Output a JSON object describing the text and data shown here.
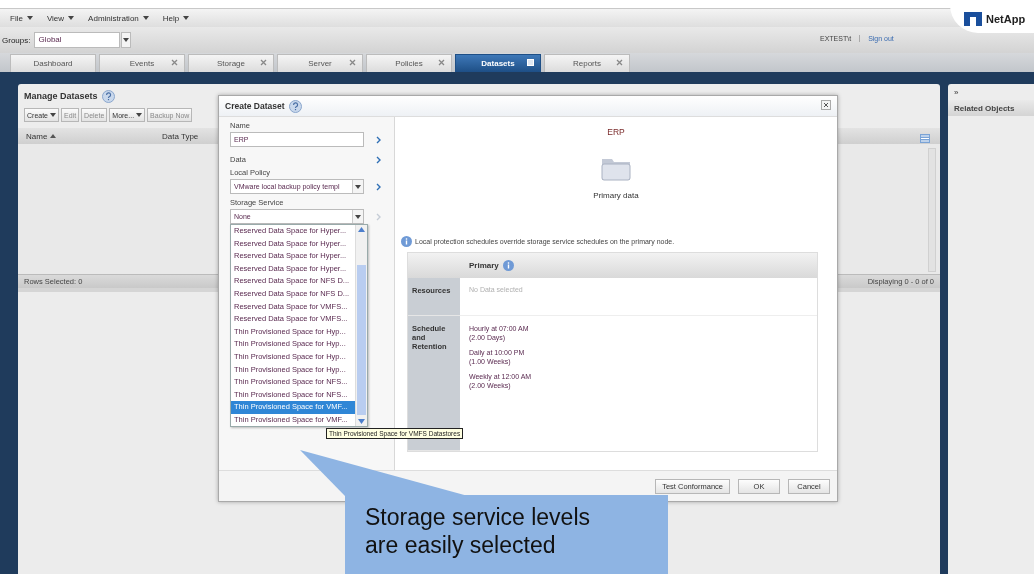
{
  "menu": [
    {
      "label": "File"
    },
    {
      "label": "View"
    },
    {
      "label": "Administration"
    },
    {
      "label": "Help"
    }
  ],
  "groups": {
    "label": "Groups:",
    "value": "Global"
  },
  "user": {
    "name": "EXTEST\\t",
    "link": "Sign out"
  },
  "logo": "NetApp",
  "tabs": [
    {
      "label": "Dashboard",
      "selected": false,
      "closable": false
    },
    {
      "label": "Events",
      "selected": false,
      "closable": true
    },
    {
      "label": "Storage",
      "selected": false,
      "closable": true
    },
    {
      "label": "Server",
      "selected": false,
      "closable": true
    },
    {
      "label": "Policies",
      "selected": false,
      "closable": true
    },
    {
      "label": "Datasets",
      "selected": true,
      "closable": true
    },
    {
      "label": "Reports",
      "selected": false,
      "closable": true
    }
  ],
  "manage": {
    "title": "Manage Datasets",
    "toolbar": [
      {
        "label": "Create",
        "dropdown": true,
        "disabled": false
      },
      {
        "label": "Edit",
        "dropdown": false,
        "disabled": true
      },
      {
        "label": "Delete",
        "dropdown": false,
        "disabled": true
      },
      {
        "label": "More...",
        "dropdown": true,
        "disabled": false
      },
      {
        "label": "Backup Now",
        "dropdown": false,
        "disabled": true
      }
    ],
    "columns": [
      {
        "label": "Name",
        "sorted": true
      },
      {
        "label": "Data Type",
        "sorted": false
      }
    ],
    "rows_selected": "Rows Selected: 0",
    "displaying": "Displaying 0 - 0 of 0"
  },
  "related": {
    "toggle": "»",
    "title": "Related Objects"
  },
  "dialog": {
    "title": "Create Dataset",
    "fields": [
      {
        "kind": "text",
        "label": "Name",
        "value": "ERP",
        "next_enabled": true
      },
      {
        "kind": "plain",
        "label": "Data",
        "next_enabled": true
      },
      {
        "kind": "select",
        "label": "Local Policy",
        "value": "VMware local backup policy templ",
        "next_enabled": true
      },
      {
        "kind": "select",
        "label": "Storage Service",
        "value": "None",
        "next_enabled": false
      }
    ],
    "options": [
      {
        "label": "Reserved Data Space for Hyper...",
        "selected": false
      },
      {
        "label": "Reserved Data Space for Hyper...",
        "selected": false
      },
      {
        "label": "Reserved Data Space for Hyper...",
        "selected": false
      },
      {
        "label": "Reserved Data Space for Hyper...",
        "selected": false
      },
      {
        "label": "Reserved Data Space for NFS D...",
        "selected": false
      },
      {
        "label": "Reserved Data Space for NFS D...",
        "selected": false
      },
      {
        "label": "Reserved Data Space for VMFS...",
        "selected": false
      },
      {
        "label": "Reserved Data Space for VMFS...",
        "selected": false
      },
      {
        "label": "Thin Provisioned Space for Hyp...",
        "selected": false
      },
      {
        "label": "Thin Provisioned Space for Hyp...",
        "selected": false
      },
      {
        "label": "Thin Provisioned Space for Hyp...",
        "selected": false
      },
      {
        "label": "Thin Provisioned Space for Hyp...",
        "selected": false
      },
      {
        "label": "Thin Provisioned Space for NFS...",
        "selected": false
      },
      {
        "label": "Thin Provisioned Space for NFS...",
        "selected": false
      },
      {
        "label": "Thin Provisioned Space for VMF...",
        "selected": true
      },
      {
        "label": "Thin Provisioned Space for VMF...",
        "selected": false
      }
    ],
    "tooltip": "Thin Provisioned Space for VMFS Datastores",
    "preview": {
      "name": "ERP",
      "caption": "Primary data",
      "note": "Local protection schedules override storage service schedules on the primary node.",
      "column": "Primary",
      "resources_label": "Resources",
      "resources": "No Data selected",
      "schedule_label": "Schedule and Retention",
      "schedules": [
        {
          "when": "Hourly at 07:00 AM",
          "retention": "(2.00 Days)"
        },
        {
          "when": "Daily at 10:00 PM",
          "retention": "(1.00 Weeks)"
        },
        {
          "when": "Weekly at 12:00 AM",
          "retention": "(2.00 Weeks)"
        }
      ]
    },
    "buttons": [
      "Test Conformance",
      "OK",
      "Cancel"
    ]
  },
  "callout": "Storage service levels are easily selected"
}
